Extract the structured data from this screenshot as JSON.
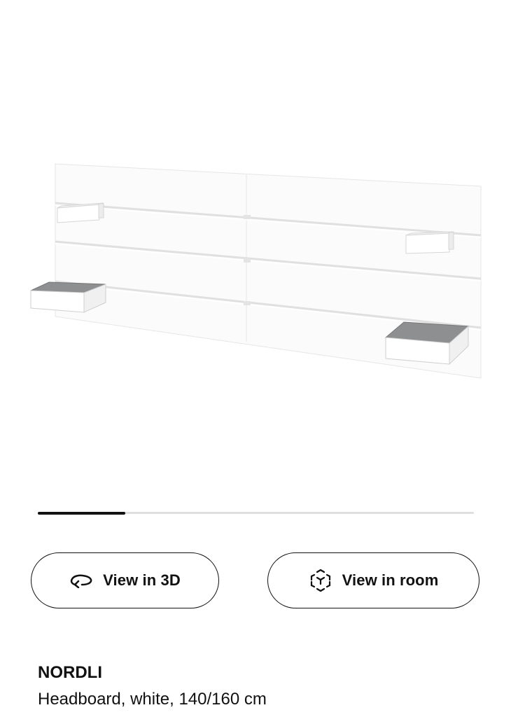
{
  "gallery": {
    "image_alt": "NORDLI headboard, white",
    "progress_fraction": 0.2
  },
  "actions": {
    "view_3d_label": "View in 3D",
    "view_3d_icon": "rotate-3d-icon",
    "view_room_label": "View in room",
    "view_room_icon": "ar-cube-icon"
  },
  "product": {
    "name": "NORDLI",
    "description": "Headboard, white, 140/160 cm"
  },
  "colors": {
    "text": "#111111",
    "progress_fill": "#111111",
    "progress_track": "#dfdfdf",
    "felt_pad": "#8e8f91"
  }
}
